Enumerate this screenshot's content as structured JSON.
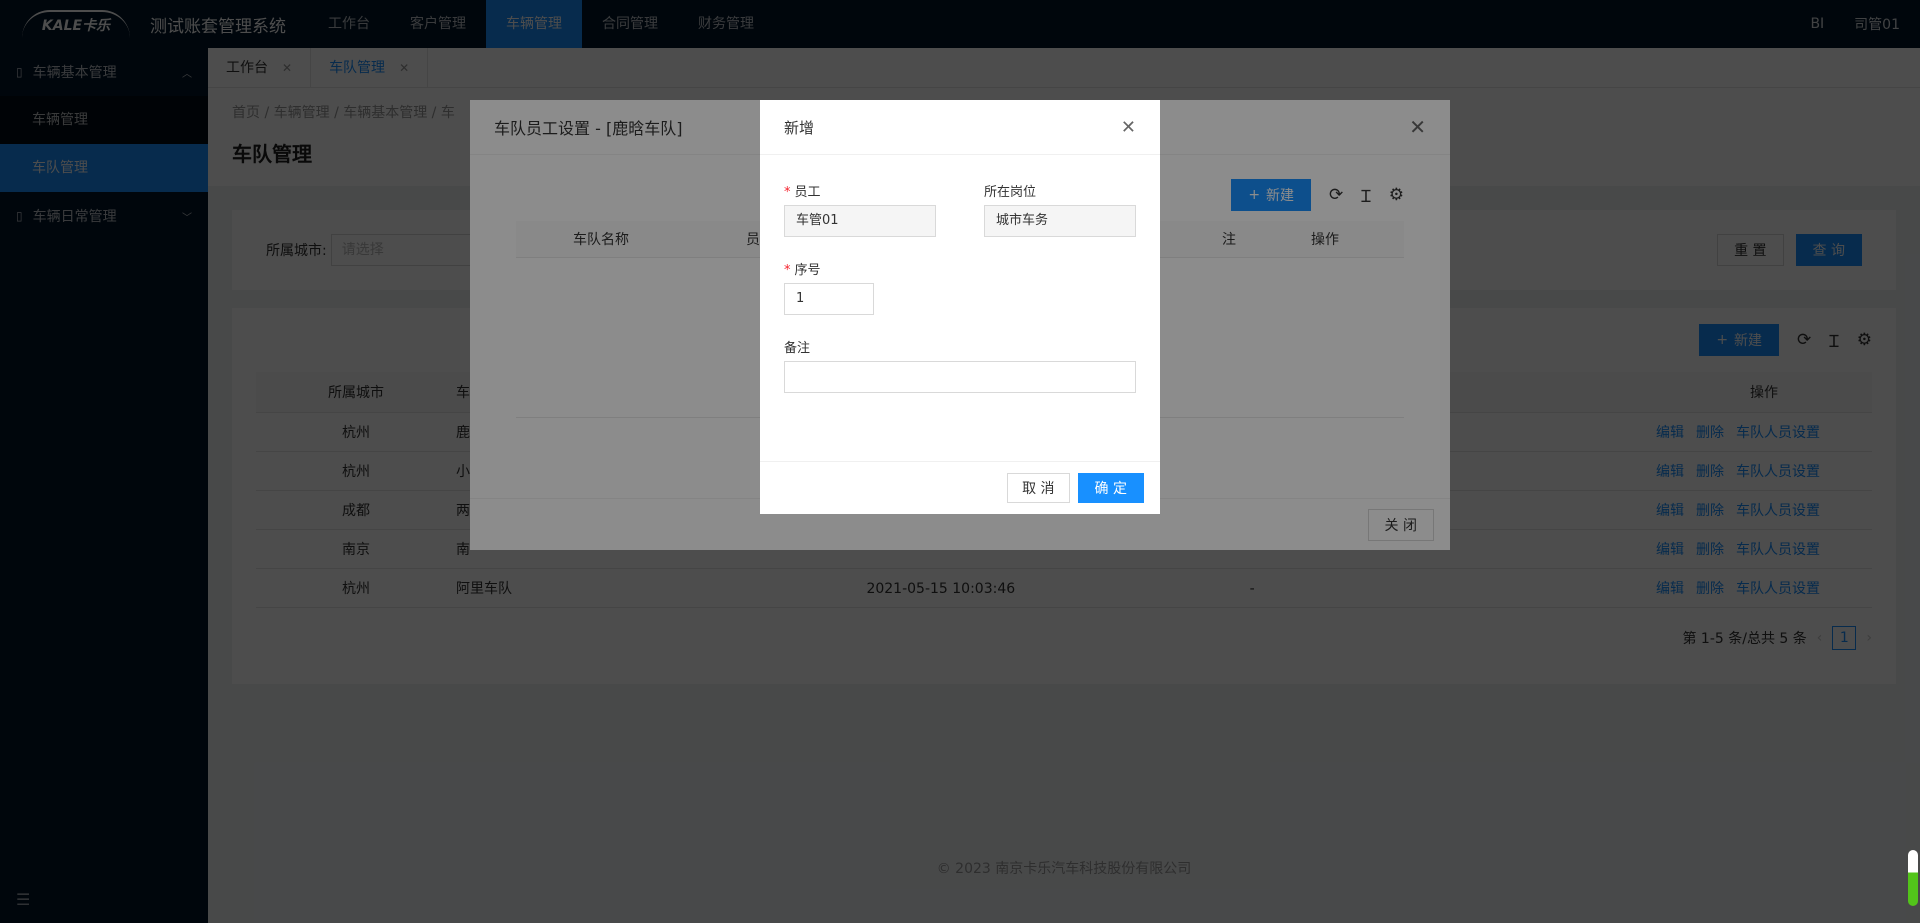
{
  "app": {
    "logo": "KALE卡乐",
    "title": "测试账套管理系统"
  },
  "nav": [
    "工作台",
    "客户管理",
    "车辆管理",
    "合同管理",
    "财务管理"
  ],
  "topRight": {
    "bi": "BI",
    "user": "司管01"
  },
  "sidebar": {
    "group1": "车辆基本管理",
    "items": [
      "车辆管理",
      "车队管理"
    ],
    "group2": "车辆日常管理"
  },
  "tabs": [
    "工作台",
    "车队管理"
  ],
  "breadcrumb": "首页 / 车辆管理 / 车辆基本管理 / 车",
  "pageTitle": "车队管理",
  "search": {
    "cityLabel": "所属城市:",
    "cityPlaceholder": "请选择",
    "reset": "重 置",
    "query": "查 询"
  },
  "toolbar": {
    "new": "新建"
  },
  "table": {
    "headers": [
      "所属城市",
      "车",
      "操作"
    ],
    "rows": [
      {
        "city": "杭州",
        "name": "鹿",
        "time": "",
        "remark": ""
      },
      {
        "city": "杭州",
        "name": "小",
        "time": "",
        "remark": ""
      },
      {
        "city": "成都",
        "name": "两",
        "time": "",
        "remark": ""
      },
      {
        "city": "南京",
        "name": "南",
        "time": "",
        "remark": ""
      },
      {
        "city": "杭州",
        "name": "阿里车队",
        "time": "2021-05-15 10:03:46",
        "remark": "-"
      }
    ],
    "ops": {
      "edit": "编辑",
      "del": "删除",
      "staff": "车队人员设置"
    }
  },
  "pager": {
    "text": "第 1-5 条/总共 5 条",
    "page": "1"
  },
  "footer": "© 2023 南京卡乐汽车科技股份有限公司",
  "modal1": {
    "title": "车队员工设置 - [鹿晗车队]",
    "new": "新建",
    "headers": [
      "车队名称",
      "员",
      "注",
      "操作"
    ],
    "close": "关 闭"
  },
  "modal2": {
    "title": "新增",
    "employeeLabel": "员工",
    "employeeValue": "车管01",
    "postLabel": "所在岗位",
    "postValue": "城市车务",
    "seqLabel": "序号",
    "seqValue": "1",
    "remarkLabel": "备注",
    "remarkValue": "",
    "cancel": "取 消",
    "ok": "确 定"
  }
}
